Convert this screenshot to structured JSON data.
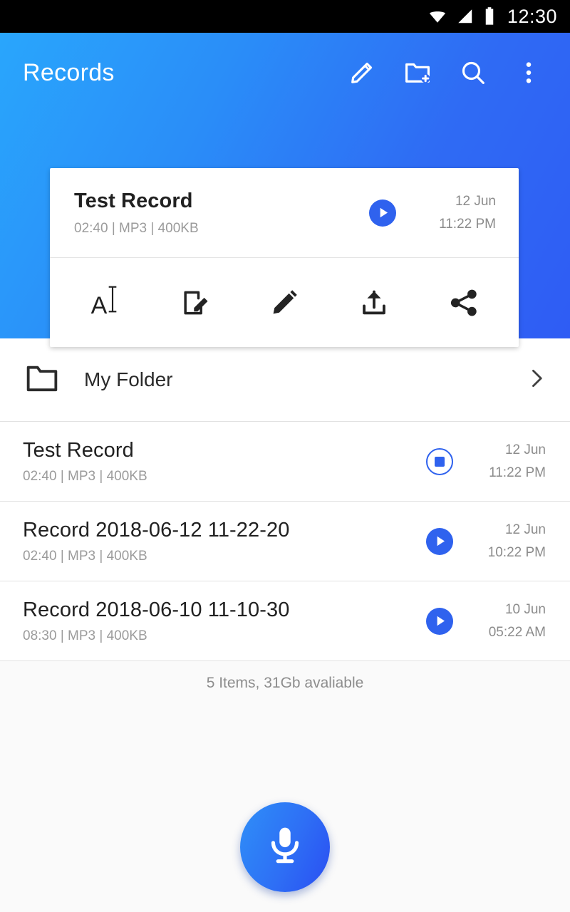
{
  "statusbar": {
    "time": "12:30",
    "icons": [
      "wifi-icon",
      "cell-signal-icon",
      "battery-full-icon"
    ]
  },
  "appbar": {
    "title": "Records",
    "actions": [
      {
        "name": "edit-icon",
        "label": "Edit"
      },
      {
        "name": "create-folder-icon",
        "label": "New folder"
      },
      {
        "name": "search-icon",
        "label": "Search"
      },
      {
        "name": "more-options-icon",
        "label": "More options"
      }
    ]
  },
  "player_card": {
    "title": "Test Record",
    "meta": "02:40 | MP3 | 400KB",
    "transport": {
      "state": "play",
      "icon": "play-icon"
    },
    "date": "12 Jun",
    "time": "11:22 PM",
    "actions": [
      {
        "name": "rename-icon",
        "label": "Rename",
        "glyph": "A"
      },
      {
        "name": "edit-note-icon",
        "label": "Note"
      },
      {
        "name": "pencil-icon",
        "label": "Edit"
      },
      {
        "name": "upload-icon",
        "label": "Upload"
      },
      {
        "name": "share-icon",
        "label": "Share"
      }
    ]
  },
  "folder_row": {
    "icon": "folder-icon",
    "name": "My Folder",
    "chevron": "chevron-right-icon"
  },
  "records": [
    {
      "title": "Test Record",
      "meta": "02:40 | MP3 | 400KB",
      "state": "playing",
      "icon": "stop-icon",
      "date": "12 Jun",
      "time": "11:22 PM"
    },
    {
      "title": "Record 2018-06-12 11-22-20",
      "meta": "02:40 | MP3 | 400KB",
      "state": "idle",
      "icon": "play-icon",
      "date": "12 Jun",
      "time": "10:22 PM"
    },
    {
      "title": "Record 2018-06-10 11-10-30",
      "meta": "08:30 | MP3 | 400KB",
      "state": "idle",
      "icon": "play-icon",
      "date": "10 Jun",
      "time": "05:22 AM"
    }
  ],
  "footer": {
    "summary": "5 Items, 31Gb avaliable"
  },
  "fab": {
    "icon": "microphone-icon",
    "label": "Record"
  },
  "colors": {
    "accent_blue": "#2f62ee",
    "header_light": "#29a6fc",
    "header_dark": "#2f5cf4",
    "statusbar": "#000000",
    "surface": "#ffffff",
    "background": "#fafafa",
    "text_primary": "#212121",
    "text_secondary": "#9b9b9b"
  }
}
